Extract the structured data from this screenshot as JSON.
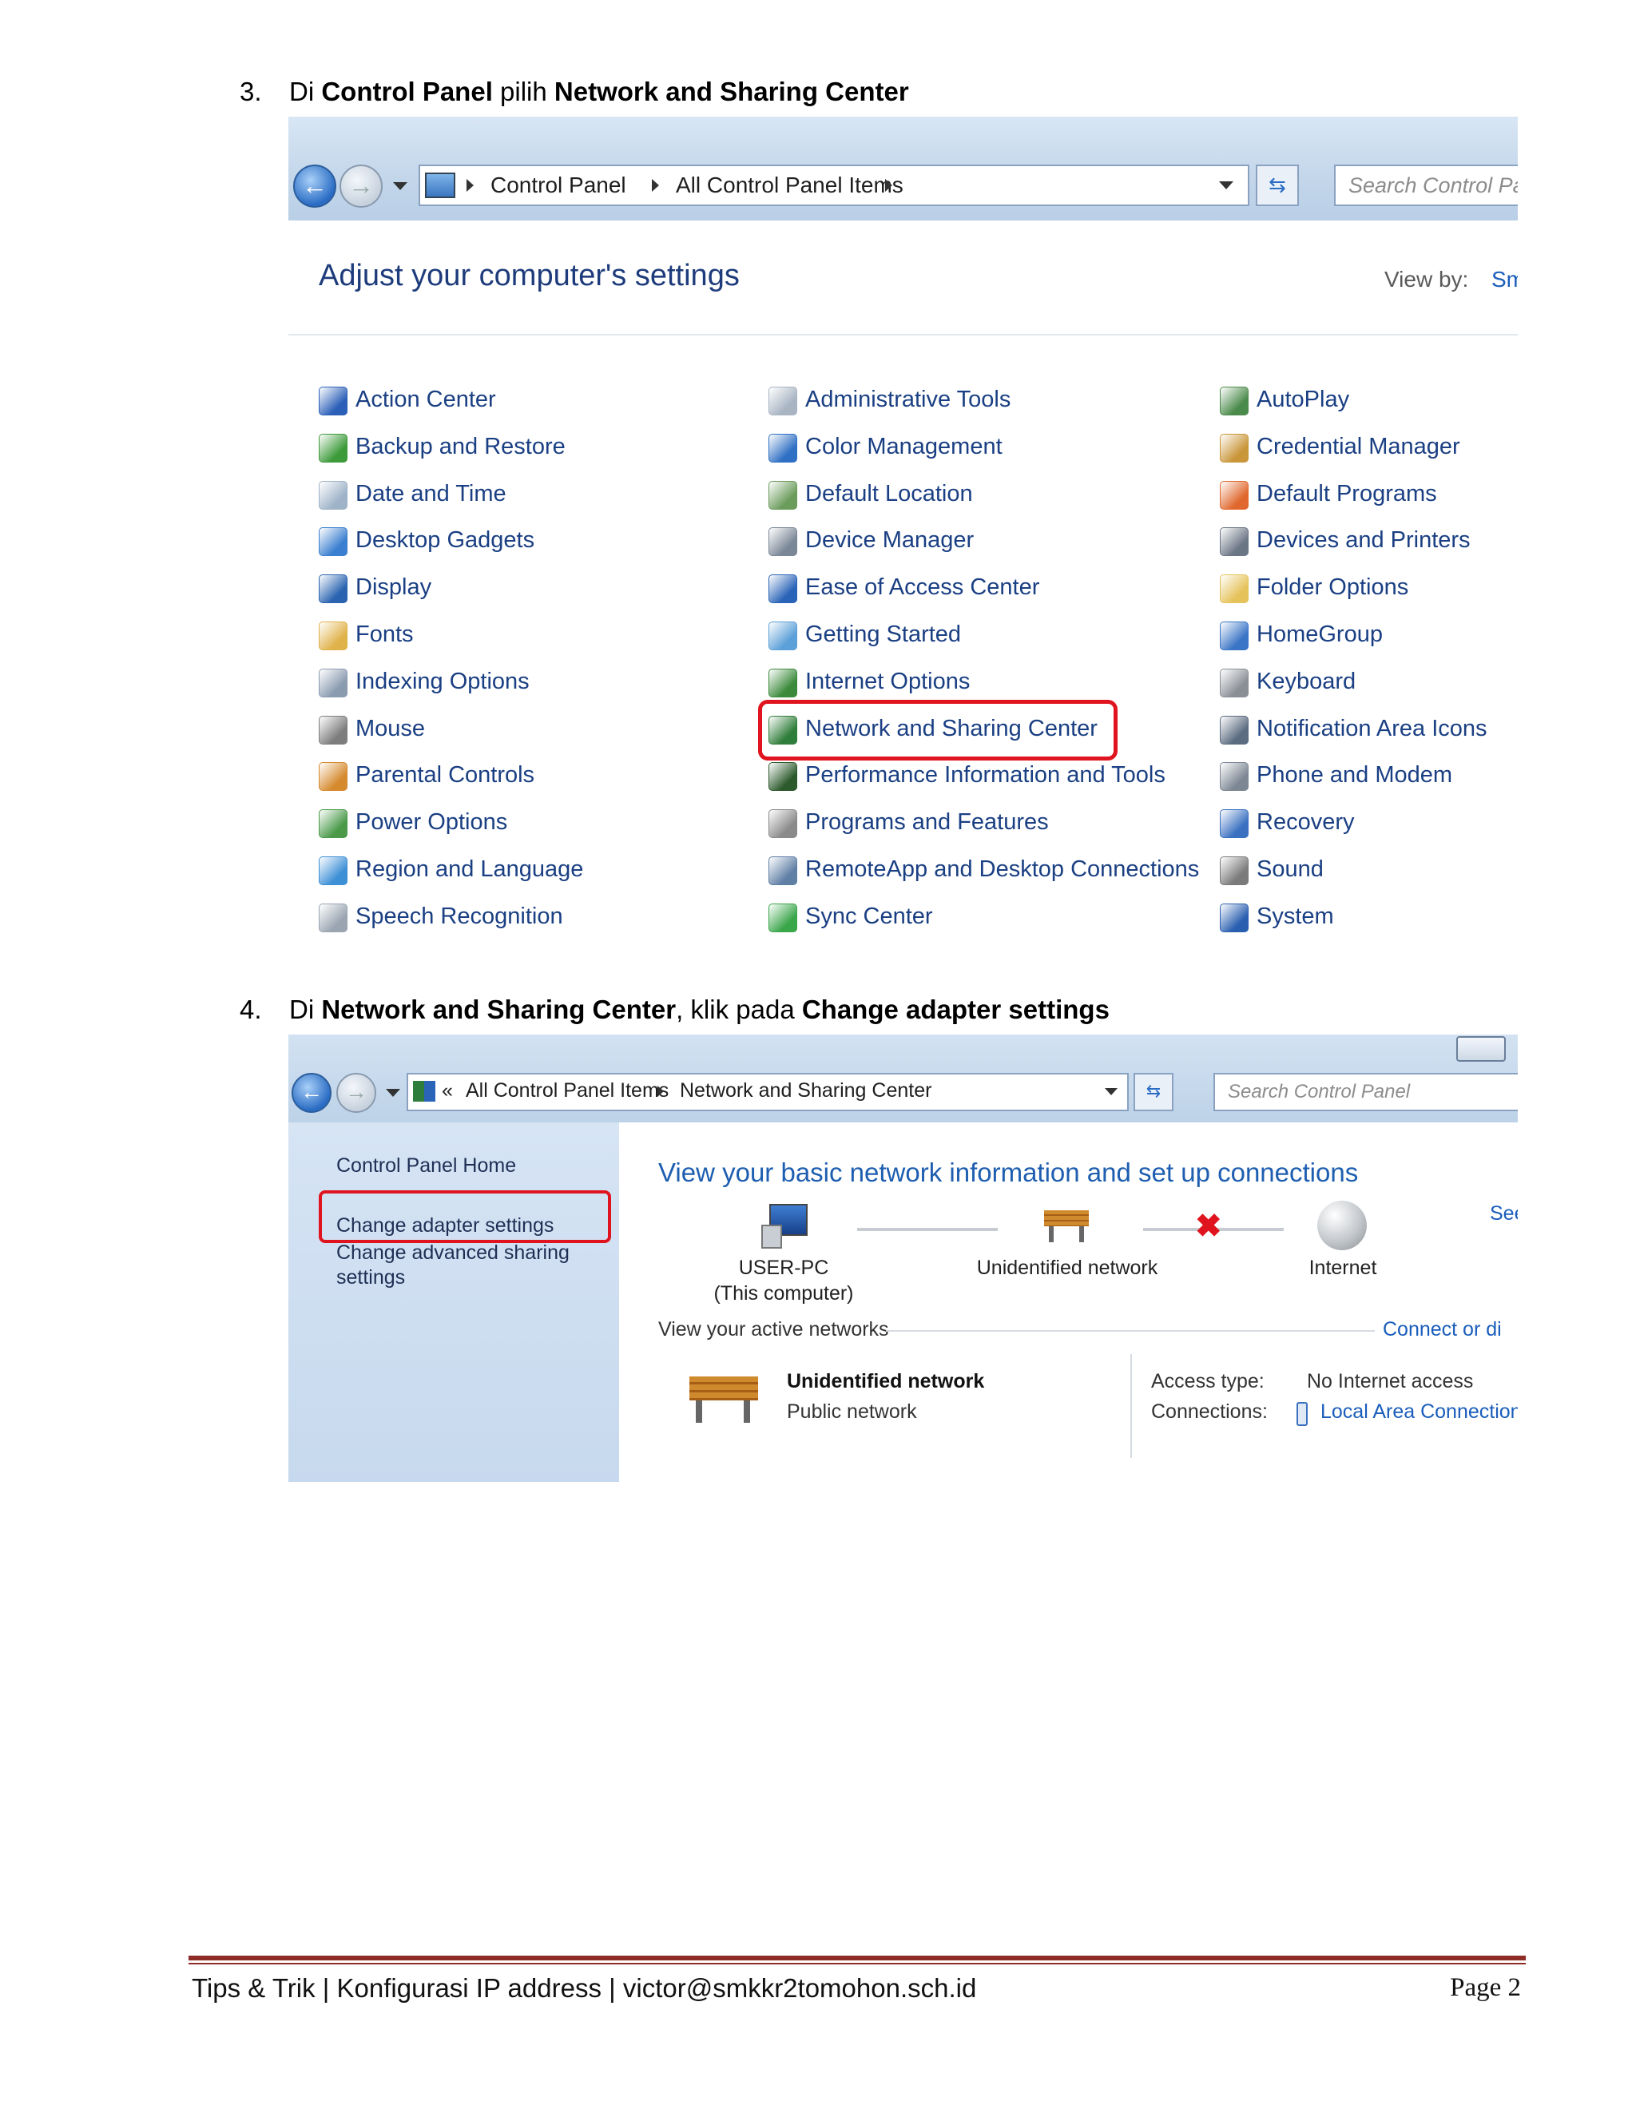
{
  "step3": {
    "number": "3.",
    "prefix": "Di ",
    "bold1": "Control Panel",
    "mid": " pilih ",
    "bold2": "Network and Sharing Center"
  },
  "step4": {
    "number": "4.",
    "prefix": "Di ",
    "bold1": "Network and Sharing Center",
    "mid": ", klik pada ",
    "bold2": "Change adapter settings"
  },
  "shot1": {
    "breadcrumb": [
      "Control Panel",
      "All Control Panel Items"
    ],
    "search_placeholder": "Search Control Pa",
    "heading": "Adjust your computer's settings",
    "view_by_label": "View by:",
    "view_by_value": "Sm",
    "columns": [
      [
        {
          "label": "Action Center",
          "icon": "flag-icon",
          "color": "#2b5fb8"
        },
        {
          "label": "Backup and Restore",
          "icon": "backup-icon",
          "color": "#3d9a3a"
        },
        {
          "label": "Date and Time",
          "icon": "clock-icon",
          "color": "#9fb3c8"
        },
        {
          "label": "Desktop Gadgets",
          "icon": "gadgets-icon",
          "color": "#3a7fd0"
        },
        {
          "label": "Display",
          "icon": "display-icon",
          "color": "#2a63b0"
        },
        {
          "label": "Fonts",
          "icon": "fonts-icon",
          "color": "#e0b24a"
        },
        {
          "label": "Indexing Options",
          "icon": "indexing-icon",
          "color": "#8a9bb0"
        },
        {
          "label": "Mouse",
          "icon": "mouse-icon",
          "color": "#7d7d7d"
        },
        {
          "label": "Parental Controls",
          "icon": "parental-icon",
          "color": "#d68a2e"
        },
        {
          "label": "Power Options",
          "icon": "power-icon",
          "color": "#4a9a4a"
        },
        {
          "label": "Region and Language",
          "icon": "globe-icon",
          "color": "#3d8fd6"
        },
        {
          "label": "Speech Recognition",
          "icon": "microphone-icon",
          "color": "#9aa5b1"
        }
      ],
      [
        {
          "label": "Administrative Tools",
          "icon": "admin-tools-icon",
          "color": "#a8b4c2"
        },
        {
          "label": "Color Management",
          "icon": "color-mgmt-icon",
          "color": "#2f6fc4"
        },
        {
          "label": "Default Location",
          "icon": "location-icon",
          "color": "#6b9c5b"
        },
        {
          "label": "Device Manager",
          "icon": "device-manager-icon",
          "color": "#7a8797"
        },
        {
          "label": "Ease of Access Center",
          "icon": "ease-access-icon",
          "color": "#2a64b8"
        },
        {
          "label": "Getting Started",
          "icon": "getting-started-icon",
          "color": "#5ba0d8"
        },
        {
          "label": "Internet Options",
          "icon": "internet-options-icon",
          "color": "#3b8a3b"
        },
        {
          "label": "Network and Sharing Center",
          "icon": "network-icon",
          "color": "#2f7d3a"
        },
        {
          "label": "Performance Information and Tools",
          "icon": "performance-icon",
          "color": "#2d5a2d"
        },
        {
          "label": "Programs and Features",
          "icon": "programs-icon",
          "color": "#8a8a8a"
        },
        {
          "label": "RemoteApp and Desktop Connections",
          "icon": "remoteapp-icon",
          "color": "#5f7fa5"
        },
        {
          "label": "Sync Center",
          "icon": "sync-icon",
          "color": "#3aa64a"
        }
      ],
      [
        {
          "label": "AutoPlay",
          "icon": "autoplay-icon",
          "color": "#4a8a4a"
        },
        {
          "label": "Credential Manager",
          "icon": "credential-icon",
          "color": "#c9963a"
        },
        {
          "label": "Default Programs",
          "icon": "default-programs-icon",
          "color": "#e0682e"
        },
        {
          "label": "Devices and Printers",
          "icon": "printer-icon",
          "color": "#6b7685"
        },
        {
          "label": "Folder Options",
          "icon": "folder-icon",
          "color": "#e5c25a"
        },
        {
          "label": "HomeGroup",
          "icon": "homegroup-icon",
          "color": "#3a74c6"
        },
        {
          "label": "Keyboard",
          "icon": "keyboard-icon",
          "color": "#8a8f96"
        },
        {
          "label": "Notification Area Icons",
          "icon": "notification-icon",
          "color": "#5b6b80"
        },
        {
          "label": "Phone and Modem",
          "icon": "phone-modem-icon",
          "color": "#7d8794"
        },
        {
          "label": "Recovery",
          "icon": "recovery-icon",
          "color": "#3a70c0"
        },
        {
          "label": "Sound",
          "icon": "sound-icon",
          "color": "#7a7a7a"
        },
        {
          "label": "System",
          "icon": "system-icon",
          "color": "#2a5fb0"
        }
      ]
    ]
  },
  "shot2": {
    "breadcrumb_prefix": "«",
    "breadcrumb": [
      "All Control Panel Items",
      "Network and Sharing Center"
    ],
    "search_placeholder": "Search Control Panel",
    "sidebar": {
      "home": "Control Panel Home",
      "change_adapter": "Change adapter settings",
      "advanced_line1": "Change advanced sharing",
      "advanced_line2": "settings"
    },
    "heading": "View your basic network information and set up connections",
    "see_link": "See",
    "map": {
      "computer_name": "USER-PC",
      "computer_sub": "(This computer)",
      "network": "Unidentified network",
      "internet": "Internet"
    },
    "active_networks_label": "View your active networks",
    "connect_link": "Connect or di",
    "active": {
      "name": "Unidentified network",
      "type": "Public network",
      "access_label": "Access type:",
      "access_value": "No Internet access",
      "connections_label": "Connections:",
      "connections_value": "Local Area Connection"
    }
  },
  "footer": {
    "left": "Tips & Trik | Konfigurasi IP address | victor@smkkr2tomohon.sch.id",
    "right": "Page 2"
  },
  "colors": {
    "highlight": "#e0141e",
    "footer_rule": "#8e2d27",
    "link": "#1a5dbb",
    "heading": "#1e3c7b"
  }
}
